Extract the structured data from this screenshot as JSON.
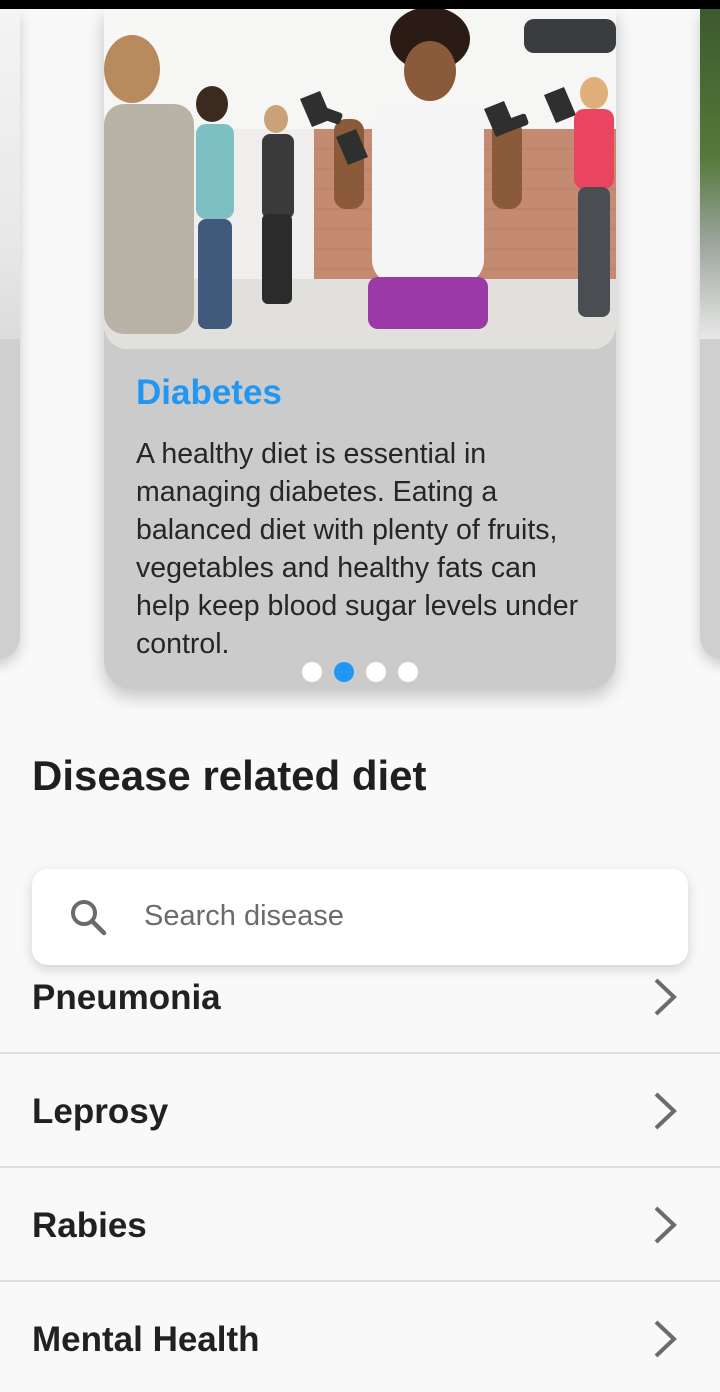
{
  "carousel": {
    "card": {
      "title": "Diabetes",
      "description": "A healthy diet is essential in managing diabetes. Eating a balanced diet with plenty of fruits, vegetables and healthy fats can help keep blood sugar levels under control."
    },
    "page_count": 4,
    "active_index": 1
  },
  "section": {
    "heading": "Disease related diet"
  },
  "search": {
    "placeholder": "Search disease",
    "icon": "search-icon"
  },
  "diseases": [
    {
      "label": "Pneumonia"
    },
    {
      "label": "Leprosy"
    },
    {
      "label": "Rabies"
    },
    {
      "label": "Mental Health"
    }
  ],
  "colors": {
    "accent": "#2196f3",
    "card_background": "#cbcbcb",
    "page_background": "#f9f9f9"
  }
}
